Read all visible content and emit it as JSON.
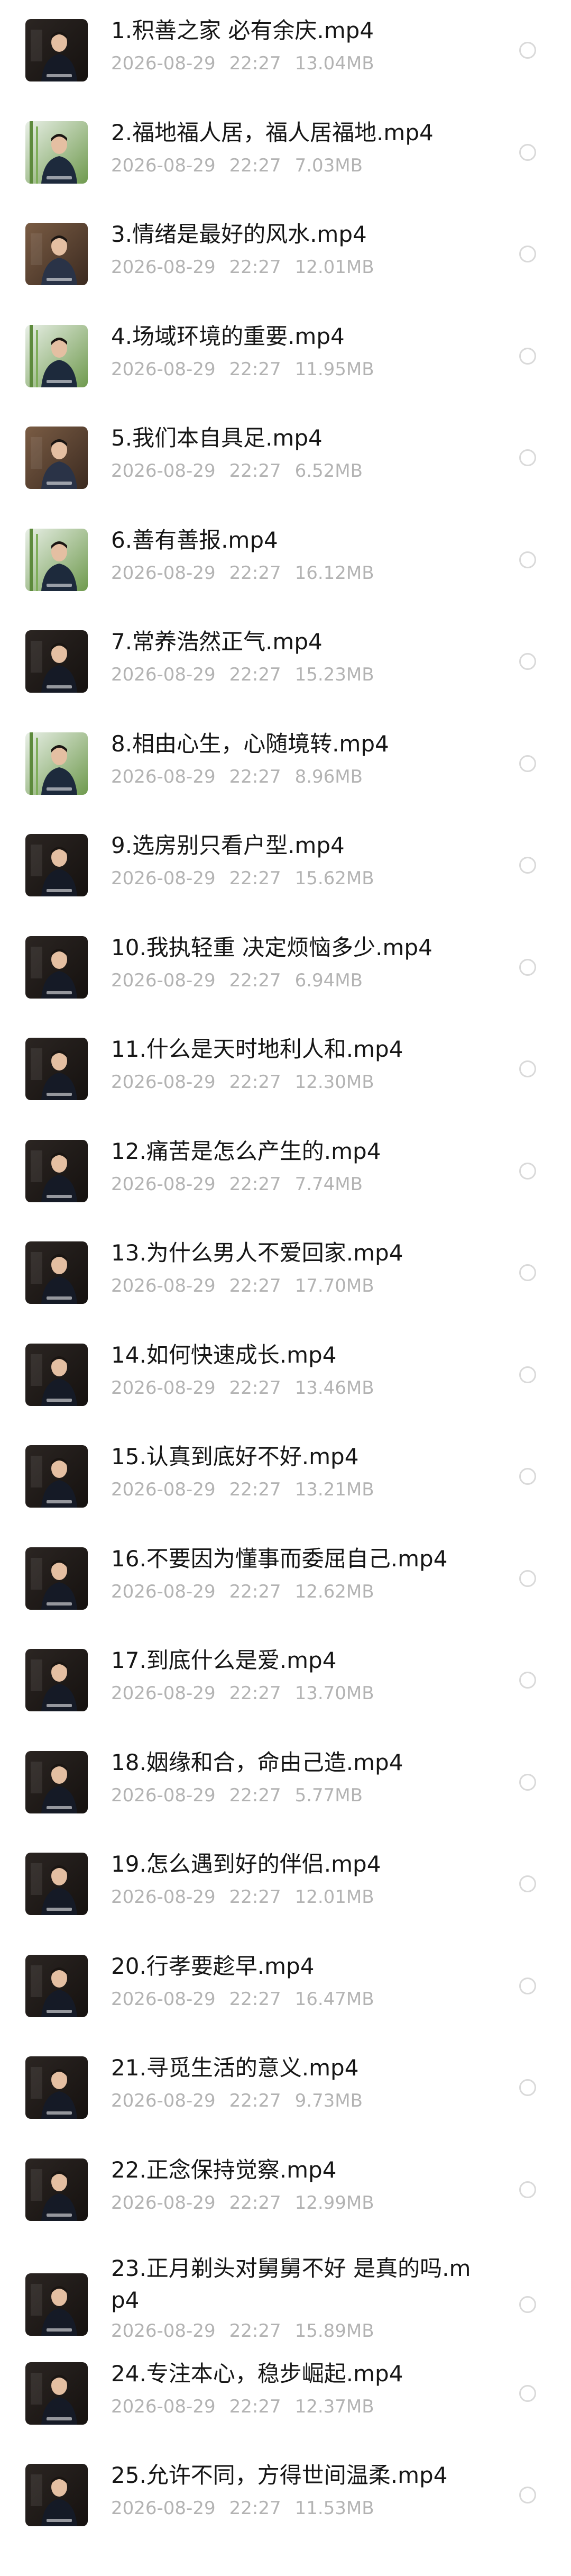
{
  "colors": {
    "background": "#ffffff",
    "title_text": "#161616",
    "meta_text": "#b3b3b3",
    "radio_border": "#d9d9d9"
  },
  "icons": {
    "thumbnail": "video-thumbnail-icon",
    "select": "radio-unchecked-icon"
  },
  "files": [
    {
      "name": "1.积善之家 必有余庆.mp4",
      "date": "2026-08-29",
      "time": "22:27",
      "size": "13.04MB",
      "thumb": "dark"
    },
    {
      "name": "2.福地福人居，福人居福地.mp4",
      "date": "2026-08-29",
      "time": "22:27",
      "size": "7.03MB",
      "thumb": "bamboo"
    },
    {
      "name": "3.情绪是最好的风水.mp4",
      "date": "2026-08-29",
      "time": "22:27",
      "size": "12.01MB",
      "thumb": "warm"
    },
    {
      "name": "4.场域环境的重要.mp4",
      "date": "2026-08-29",
      "time": "22:27",
      "size": "11.95MB",
      "thumb": "bamboo"
    },
    {
      "name": "5.我们本自具足.mp4",
      "date": "2026-08-29",
      "time": "22:27",
      "size": "6.52MB",
      "thumb": "warm"
    },
    {
      "name": "6.善有善报.mp4",
      "date": "2026-08-29",
      "time": "22:27",
      "size": "16.12MB",
      "thumb": "bamboo"
    },
    {
      "name": "7.常养浩然正气.mp4",
      "date": "2026-08-29",
      "time": "22:27",
      "size": "15.23MB",
      "thumb": "dark"
    },
    {
      "name": "8.相由心生，心随境转.mp4",
      "date": "2026-08-29",
      "time": "22:27",
      "size": "8.96MB",
      "thumb": "bamboo"
    },
    {
      "name": "9.选房别只看户型.mp4",
      "date": "2026-08-29",
      "time": "22:27",
      "size": "15.62MB",
      "thumb": "dark"
    },
    {
      "name": "10.我执轻重 决定烦恼多少.mp4",
      "date": "2026-08-29",
      "time": "22:27",
      "size": "6.94MB",
      "thumb": "dark"
    },
    {
      "name": "11.什么是天时地利人和.mp4",
      "date": "2026-08-29",
      "time": "22:27",
      "size": "12.30MB",
      "thumb": "dark"
    },
    {
      "name": "12.痛苦是怎么产生的.mp4",
      "date": "2026-08-29",
      "time": "22:27",
      "size": "7.74MB",
      "thumb": "dark"
    },
    {
      "name": "13.为什么男人不爱回家.mp4",
      "date": "2026-08-29",
      "time": "22:27",
      "size": "17.70MB",
      "thumb": "dark"
    },
    {
      "name": "14.如何快速成长.mp4",
      "date": "2026-08-29",
      "time": "22:27",
      "size": "13.46MB",
      "thumb": "dark"
    },
    {
      "name": "15.认真到底好不好.mp4",
      "date": "2026-08-29",
      "time": "22:27",
      "size": "13.21MB",
      "thumb": "dark"
    },
    {
      "name": "16.不要因为懂事而委屈自己.mp4",
      "date": "2026-08-29",
      "time": "22:27",
      "size": "12.62MB",
      "thumb": "dark"
    },
    {
      "name": "17.到底什么是爱.mp4",
      "date": "2026-08-29",
      "time": "22:27",
      "size": "13.70MB",
      "thumb": "dark"
    },
    {
      "name": "18.姻缘和合，命由己造.mp4",
      "date": "2026-08-29",
      "time": "22:27",
      "size": "5.77MB",
      "thumb": "dark"
    },
    {
      "name": "19.怎么遇到好的伴侣.mp4",
      "date": "2026-08-29",
      "time": "22:27",
      "size": "12.01MB",
      "thumb": "dark"
    },
    {
      "name": "20.行孝要趁早.mp4",
      "date": "2026-08-29",
      "time": "22:27",
      "size": "16.47MB",
      "thumb": "dark"
    },
    {
      "name": "21.寻觅生活的意义.mp4",
      "date": "2026-08-29",
      "time": "22:27",
      "size": "9.73MB",
      "thumb": "dark"
    },
    {
      "name": "22.正念保持觉察.mp4",
      "date": "2026-08-29",
      "time": "22:27",
      "size": "12.99MB",
      "thumb": "dark"
    },
    {
      "name": "23.正月剃头对舅舅不好 是真的吗.mp4",
      "date": "2026-08-29",
      "time": "22:27",
      "size": "15.89MB",
      "thumb": "dark"
    },
    {
      "name": "24.专注本心，稳步崛起.mp4",
      "date": "2026-08-29",
      "time": "22:27",
      "size": "12.37MB",
      "thumb": "dark"
    },
    {
      "name": "25.允许不同，方得世间温柔.mp4",
      "date": "2026-08-29",
      "time": "22:27",
      "size": "11.53MB",
      "thumb": "dark"
    }
  ]
}
